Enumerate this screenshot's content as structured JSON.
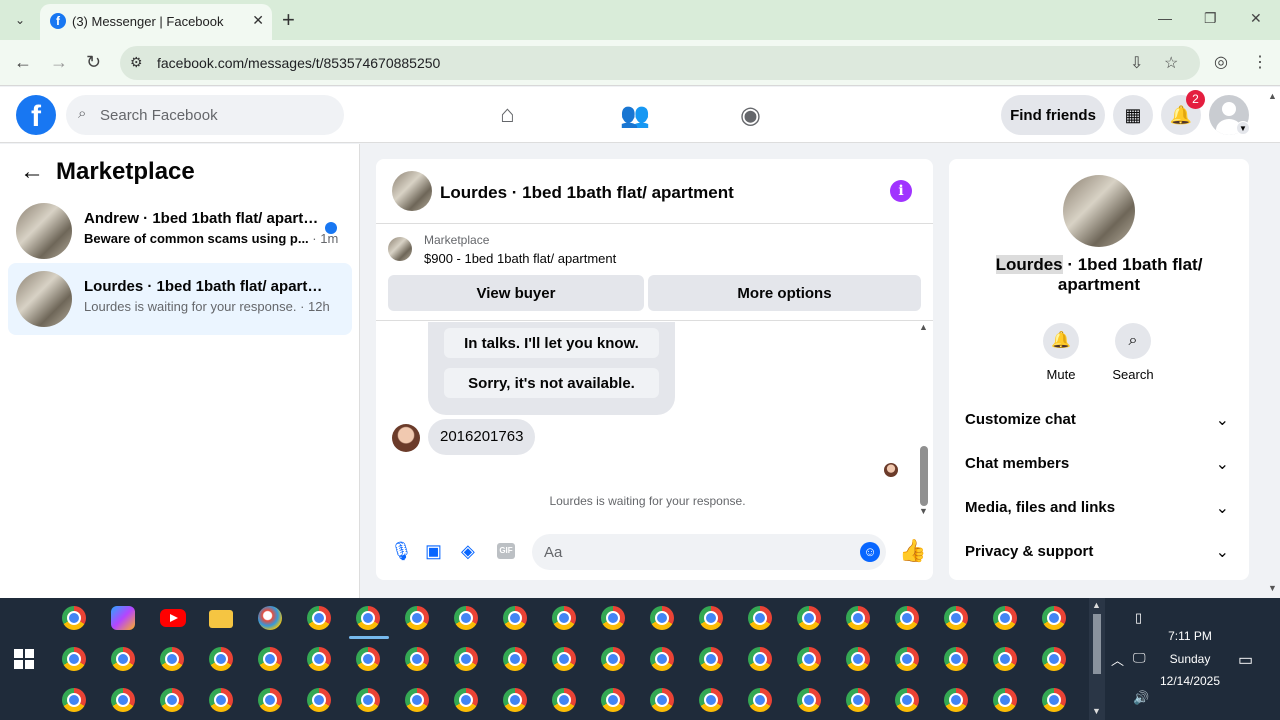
{
  "browser": {
    "tab_title": "(3) Messenger | Facebook",
    "url": "facebook.com/messages/t/853574670885250"
  },
  "fb": {
    "search_placeholder": "Search Facebook",
    "find_friends": "Find friends",
    "notification_count": "2"
  },
  "marketplace": {
    "title": "Marketplace",
    "conversations": [
      {
        "name": "Andrew · 1bed 1bath flat/ apartm...",
        "snippet": "Beware of common scams using p...",
        "time": "· 1m",
        "unread": true
      },
      {
        "name": "Lourdes · 1bed 1bath flat/ apartment",
        "snippet": "Lourdes is waiting for your response.",
        "time": "· 12h",
        "unread": false
      }
    ]
  },
  "chat": {
    "title": "Lourdes · 1bed 1bath flat/ apartment",
    "marketplace_label": "Marketplace",
    "listing": "$900 - 1bed 1bath flat/ apartment",
    "view_buyer": "View buyer",
    "more_options": "More options",
    "quick_replies": [
      "In talks. I'll let you know.",
      "Sorry, it's not available."
    ],
    "message": "2016201763",
    "waiting": "Lourdes is waiting for your response.",
    "input_placeholder": "Aa"
  },
  "details": {
    "name_first": "Lourdes",
    "name_rest": " · 1bed 1bath flat/ apartment",
    "mute": "Mute",
    "search": "Search",
    "sections": [
      "Customize chat",
      "Chat members",
      "Media, files and links",
      "Privacy & support"
    ]
  },
  "taskbar": {
    "time": "7:11 PM",
    "day": "Sunday",
    "date": "12/14/2025"
  },
  "colors": {
    "accent": "#0866ff",
    "brand": "#1877f2",
    "info": "#a033ff",
    "badge": "#e41e3f"
  }
}
